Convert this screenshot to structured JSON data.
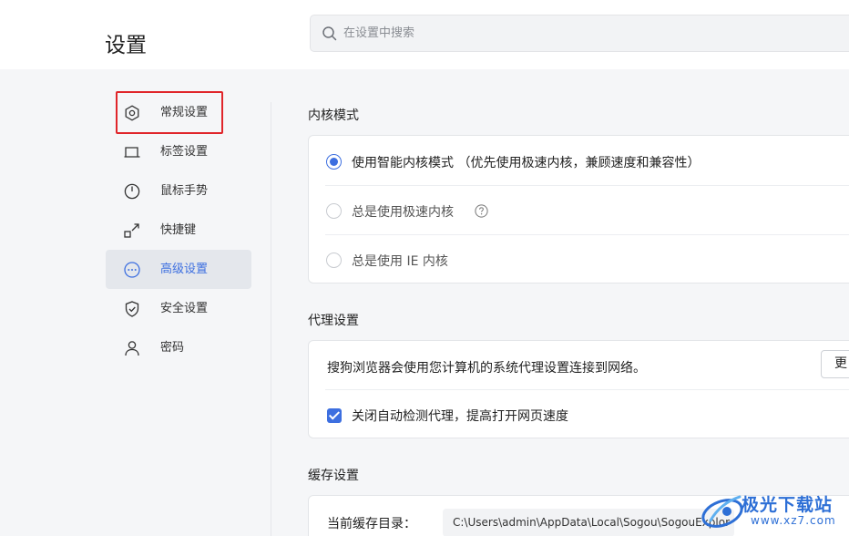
{
  "header": {
    "title": "设置",
    "search_placeholder": "在设置中搜索"
  },
  "sidebar": {
    "items": [
      {
        "label": "常规设置",
        "icon": "gear-icon"
      },
      {
        "label": "标签设置",
        "icon": "tab-icon"
      },
      {
        "label": "鼠标手势",
        "icon": "mouse-icon"
      },
      {
        "label": "快捷键",
        "icon": "shortcut-icon"
      },
      {
        "label": "高级设置",
        "icon": "more-icon",
        "active": true
      },
      {
        "label": "安全设置",
        "icon": "shield-icon"
      },
      {
        "label": "密码",
        "icon": "user-icon"
      }
    ]
  },
  "kernel": {
    "title": "内核模式",
    "options": [
      {
        "label": "使用智能内核模式 （优先使用极速内核，兼顾速度和兼容性）",
        "checked": true
      },
      {
        "label": "总是使用极速内核",
        "checked": false
      },
      {
        "label": "总是使用 IE 内核",
        "checked": false
      }
    ]
  },
  "proxy": {
    "title": "代理设置",
    "description": "搜狗浏览器会使用您计算机的系统代理设置连接到网络。",
    "button_label": "更",
    "auto_detect_label": "关闭自动检测代理，提高打开网页速度",
    "auto_detect_checked": true
  },
  "cache": {
    "title": "缓存设置",
    "dir_label": "当前缓存目录：",
    "dir_value": "C:\\Users\\admin\\AppData\\Local\\Sogou\\SogouExplor"
  },
  "watermark": {
    "brand": "极光下载站",
    "url": "www.xz7.com"
  },
  "colors": {
    "accent": "#3d6fe0",
    "highlight": "#e0252a"
  }
}
